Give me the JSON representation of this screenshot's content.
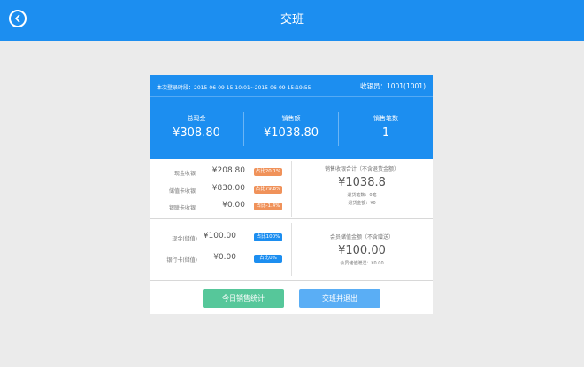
{
  "header": {
    "title": "交班"
  },
  "card": {
    "login_time": "本次登录时段：2015-06-09 15:10:01~2015-06-09 15:19:55",
    "cashier": "收银员：1001(1001)",
    "stats": [
      {
        "label": "总现金",
        "value": "¥308.80"
      },
      {
        "label": "销售额",
        "value": "¥1038.80"
      },
      {
        "label": "销售笔数",
        "value": "1"
      }
    ],
    "payments": [
      {
        "label": "现金收银",
        "value": "¥208.80",
        "badge": "占比20.1%"
      },
      {
        "label": "储值卡收银",
        "value": "¥830.00",
        "badge": "占比79.8%"
      },
      {
        "label": "银联卡收银",
        "value": "¥0.00",
        "badge": "占比-1.4%"
      }
    ],
    "sales_summary": {
      "heading": "销售收银合计（不含退货金额）",
      "amount": "¥1038.8",
      "return_count": "退货笔数：0笔",
      "return_amount": "退货金额：¥0"
    },
    "recharges": [
      {
        "label": "现金(储值)",
        "value": "¥100.00",
        "badge": "占比100%"
      },
      {
        "label": "银行卡(储值)",
        "value": "¥0.00",
        "badge": "占比0%"
      }
    ],
    "member_summary": {
      "heading": "会员储值金额（不含赠送）",
      "amount": "¥100.00",
      "gift": "会员储值赠送：¥0.00"
    },
    "buttons": {
      "today_stats": "今日销售统计",
      "handover_exit": "交班并退出"
    }
  },
  "colors": {
    "primary": "#1c8ef0",
    "green": "#56c79a",
    "light_blue": "#5aaef5",
    "orange": "#f0925a"
  }
}
